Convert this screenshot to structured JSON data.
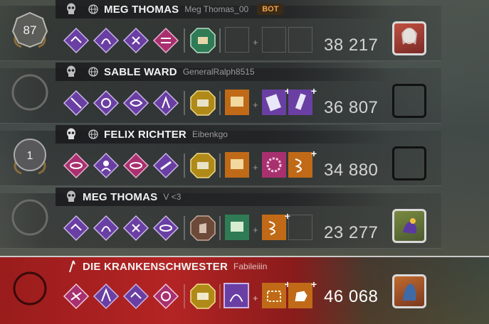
{
  "players": [
    {
      "prestige": "87",
      "name": "MEG THOMAS",
      "account": "Meg Thomas_00",
      "tag": "BOT",
      "score": "38 217",
      "perks": [
        "purple",
        "purple",
        "purple",
        "pink"
      ],
      "item": "green",
      "addons": [
        "empty",
        "empty"
      ],
      "offering": "empty",
      "character": "portrait"
    },
    {
      "prestige": "",
      "name": "SABLE WARD",
      "account": "GeneralRalph8515",
      "tag": "",
      "score": "36 807",
      "perks": [
        "purple",
        "purple",
        "purple",
        "purple"
      ],
      "item": "yellow",
      "addons": [
        "orange",
        "purple"
      ],
      "offering": "purple",
      "character": "empty"
    },
    {
      "prestige": "1",
      "name": "FELIX RICHTER",
      "account": "Eibenkgo",
      "tag": "",
      "score": "34 880",
      "perks": [
        "pink",
        "purple",
        "pink",
        "purple"
      ],
      "item": "yellow",
      "addons": [
        "orange",
        "pink"
      ],
      "offering": "orange",
      "character": "empty"
    },
    {
      "prestige": "",
      "name": "MEG THOMAS",
      "account": "V <3",
      "tag": "",
      "score": "23 277",
      "perks": [
        "purple",
        "purple",
        "purple",
        "purple"
      ],
      "item": "brown",
      "addons": [
        "green",
        "orange"
      ],
      "offering": "empty",
      "character": "portrait"
    }
  ],
  "killer": {
    "name": "DIE KRANKENSCHWESTER",
    "account": "Fabileiiin",
    "score": "46 068",
    "perks": [
      "pink",
      "purple",
      "purple",
      "pink"
    ],
    "power": "yellow",
    "addon1": "purple",
    "addons": [
      "orange",
      "orange"
    ],
    "character": "portrait"
  },
  "colors": {
    "purple": "#6a3fa3",
    "pink": "#a8306f",
    "yellow": "#b08a18",
    "orange": "#c06a18",
    "green": "#2f7b56",
    "brown": "#6b4a3a",
    "killer_red": "#a82222"
  }
}
